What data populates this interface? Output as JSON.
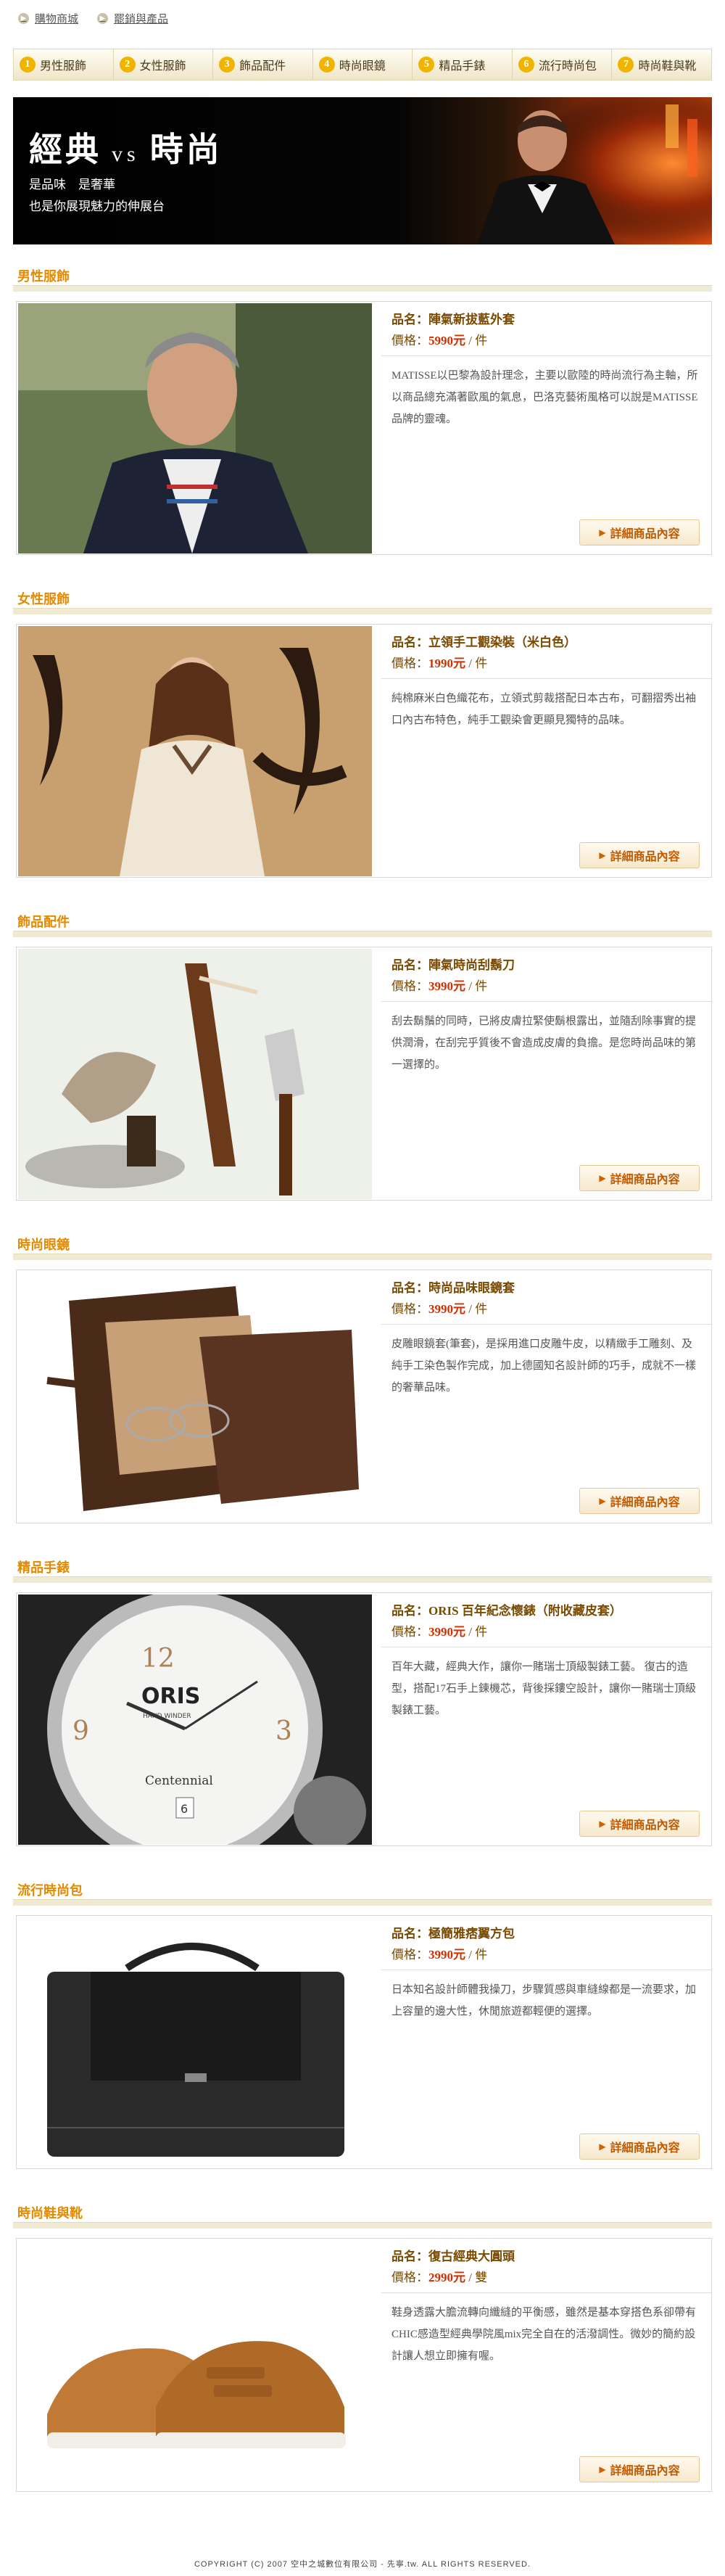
{
  "topnav": {
    "mall": "購物商城",
    "cart": "罷銷與產品"
  },
  "categories": [
    {
      "num": "1",
      "label": "男性服飾"
    },
    {
      "num": "2",
      "label": "女性服飾"
    },
    {
      "num": "3",
      "label": "飾品配件"
    },
    {
      "num": "4",
      "label": "時尚眼鏡"
    },
    {
      "num": "5",
      "label": "精品手錶"
    },
    {
      "num": "6",
      "label": "流行時尚包"
    },
    {
      "num": "7",
      "label": "時尚鞋與靴"
    }
  ],
  "banner": {
    "title_left": "經典",
    "title_vs": "vs",
    "title_right": "時尚",
    "line1": "是品味　是奢華",
    "line2": "也是你展現魅力的伸展台"
  },
  "sections": [
    {
      "heading": "男性服飾",
      "name": "品名：陣氣新拔藍外套",
      "price_label": "價格：",
      "price_value": "5990元",
      "price_unit": " / 件",
      "desc": "MATISSE以巴黎為設計理念，主要以歐陸的時尚流行為主軸，所以商品總充滿著歐風的氣息，巴洛克藝術風格可以說是MATISSE品牌的靈魂。",
      "more": "詳細商品內容"
    },
    {
      "heading": "女性服飾",
      "name": "品名：立領手工觀染裝（米白色）",
      "price_label": "價格：",
      "price_value": "1990元",
      "price_unit": " / 件",
      "desc": "純棉麻米白色織花布，立領式剪裁搭配日本古布，可翻摺秀出袖口內古布特色，純手工觀染會更顯見獨特的品味。",
      "more": "詳細商品內容"
    },
    {
      "heading": "飾品配件",
      "name": "品名：陣氣時尚刮鬍刀",
      "price_label": "價格：",
      "price_value": "3990元",
      "price_unit": " / 件",
      "desc": "刮去鬍鬚的同時，已將皮膚拉緊使鬍根露出，並隨刮除事實的提供潤滑，在刮完乎質後不會造成皮膚的負擔。是您時尚品味的第一選擇的。",
      "more": "詳細商品內容"
    },
    {
      "heading": "時尚眼鏡",
      "name": "品名：時尚品味眼鏡套",
      "price_label": "價格：",
      "price_value": "3990元",
      "price_unit": " / 件",
      "desc": "皮雕眼鏡套(筆套)，是採用進口皮雕牛皮，以精緻手工雕刻、及純手工染色製作完成，加上德國知名設計師的巧手，成就不一樣的奢華品味。",
      "more": "詳細商品內容"
    },
    {
      "heading": "精品手錶",
      "name": "品名：ORIS 百年紀念懷錶（附收藏皮套）",
      "price_label": "價格：",
      "price_value": "3990元",
      "price_unit": " / 件",
      "desc": "百年大藏，經典大作，讓你一賭瑞士頂級製錶工藝。 復古的造型，搭配17石手上鍊機芯，背後採鏤空設計，讓你一賭瑞士頂級製錶工藝。",
      "more": "詳細商品內容",
      "watch": {
        "brand": "ORIS",
        "sub": "HAND WINDER",
        "model": "Centennial",
        "date": "6"
      }
    },
    {
      "heading": "流行時尚包",
      "name": "品名：極簡雅痞翼方包",
      "price_label": "價格：",
      "price_value": "3990元",
      "price_unit": " / 件",
      "desc": "日本知名設計師體我操刀，步驟質感與車縫線都是一流要求，加上容量的邊大性，休閒旅遊都輕便的選擇。",
      "more": "詳細商品內容"
    },
    {
      "heading": "時尚鞋與靴",
      "name": "品名：復古經典大圓頭",
      "price_label": "價格：",
      "price_value": "2990元",
      "price_unit": " / 雙",
      "desc": "鞋身透露大膽流轉向纖縫的平衡感，雖然是基本穿搭色系卻帶有CHIC感造型經典學院風mix完全自在的活潑調性。微妙的簡約設計讓人想立即擁有喔。",
      "more": "詳細商品內容"
    }
  ],
  "footer": "COPYRIGHT (C) 2007 空中之城數位有限公司 - 先寧.tw. ALL RIGHTS RESERVED."
}
